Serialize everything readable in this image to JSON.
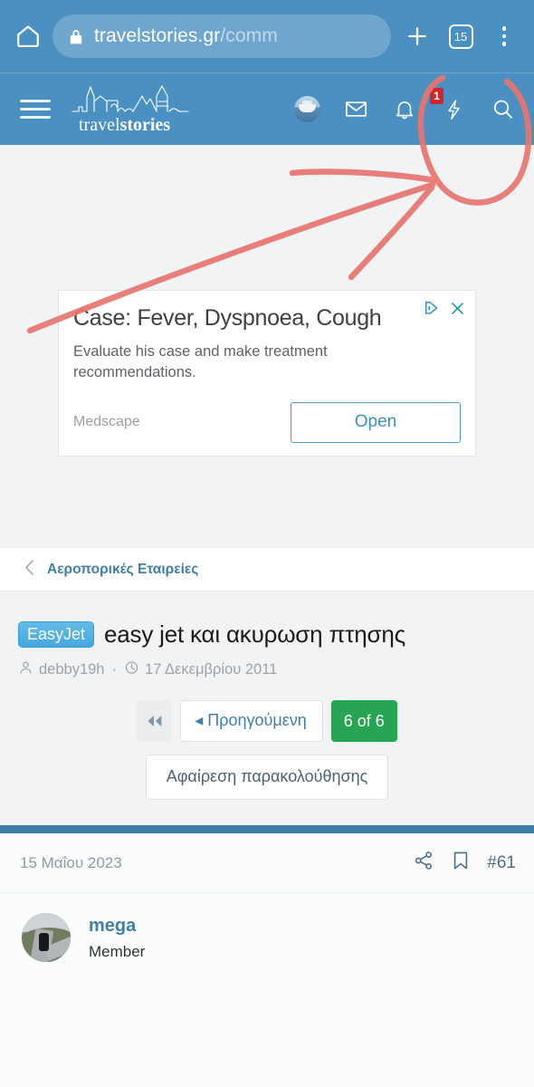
{
  "browser": {
    "home_icon": "home-icon",
    "lock_icon": "lock-icon",
    "url_main": "travelstories.gr",
    "url_path": "/comm",
    "new_tab_label": "+",
    "tab_count": "15",
    "menu_icon": "three-dot-menu-icon"
  },
  "site_header": {
    "menu_icon": "hamburger-menu-icon",
    "logo_text_light": "travel",
    "logo_text_bold": "stories",
    "user_avatar": "user-avatar-ship",
    "inbox_icon": "envelope-icon",
    "alerts_icon": "bell-icon",
    "whats_new_icon": "lightning-bolt-icon",
    "whats_new_badge": "1",
    "search_icon": "search-icon"
  },
  "ad": {
    "title": "Case: Fever, Dyspnoea, Cough",
    "body": "Evaluate his case and make treatment recommendations.",
    "brand": "Medscape",
    "open_label": "Open",
    "adchoices_icon": "adchoices-icon",
    "close_icon": "close-icon",
    "accent_color": "#3f8fc4",
    "icon_color": "#2196a8"
  },
  "breadcrumb": {
    "back_icon": "chevron-left-icon",
    "label": "Αεροπορικές Εταιρείες",
    "link_color": "#3f7fa8"
  },
  "thread": {
    "prefix": "EasyJet",
    "prefix_color": "#46a8dd",
    "title": "easy jet και ακυρωση πτησης",
    "author_icon": "person-icon",
    "author": "debby19h",
    "separator": "·",
    "date_icon": "clock-icon",
    "date": "17 Δεκεμβρίου 2011"
  },
  "pagination": {
    "first_icon": "double-chevron-left-icon",
    "prev_arrow": "◂",
    "prev_label": "Προηγούμενη",
    "current_label": "6 of 6",
    "current_color": "#28a455",
    "watch_label": "Αφαίρεση παρακολούθησης"
  },
  "post": {
    "date": "15 Μαΐου 2023",
    "share_icon": "share-icon",
    "bookmark_icon": "bookmark-icon",
    "post_number": "#61",
    "avatar": "motorcycle-avatar",
    "author_name": "mega",
    "author_role": "Member",
    "topbar_color": "#3d7ea6"
  },
  "annotation": {
    "color": "#e8756f",
    "shape": "hand-drawn-circle-with-arrows",
    "target": "search-icon"
  }
}
